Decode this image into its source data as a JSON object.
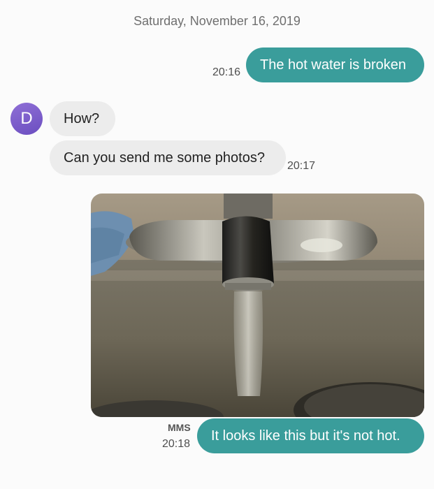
{
  "conversation": {
    "date_separator": "Saturday, November 16, 2019",
    "contact": {
      "avatar_initial": "D",
      "avatar_color": "#7b5cc9"
    },
    "messages": [
      {
        "direction": "outgoing",
        "text": "The hot water is broken",
        "time": "20:16"
      },
      {
        "direction": "incoming",
        "text": "How?"
      },
      {
        "direction": "incoming",
        "text": "Can you send me some photos?",
        "time": "20:17"
      },
      {
        "direction": "outgoing",
        "type": "mms",
        "media_icon": "photo-of-sink-faucet",
        "label": "MMS",
        "text": "It looks like this but it's not hot.",
        "time": "20:18"
      }
    ]
  },
  "colors": {
    "outgoing_bubble": "#3a9d9b",
    "incoming_bubble": "#ececec",
    "background": "#fbfbfb"
  }
}
